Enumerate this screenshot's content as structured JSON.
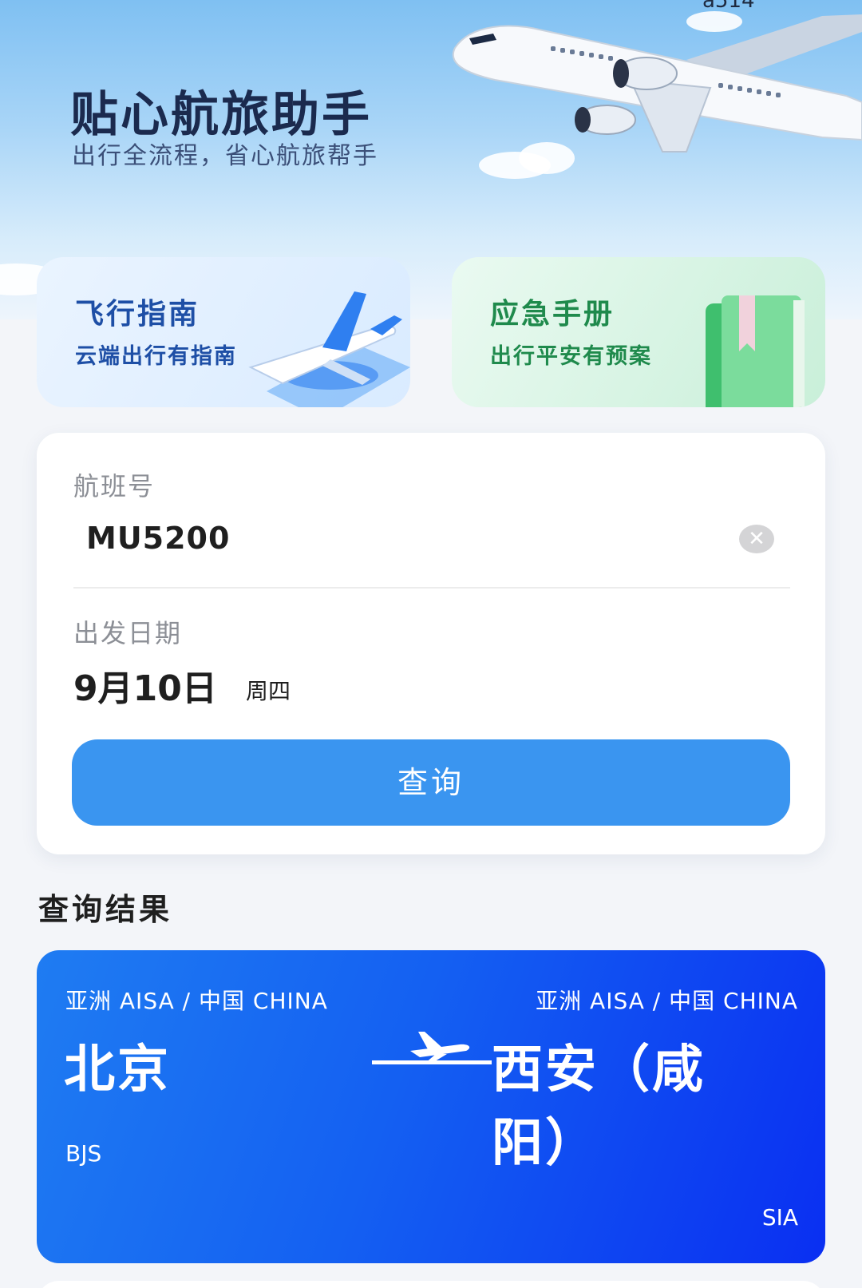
{
  "status_bar": {
    "clipped_text": "a514"
  },
  "hero": {
    "title": "贴心航旅助手",
    "subtitle": "出行全流程，省心航旅帮手"
  },
  "features": [
    {
      "title": "飞行指南",
      "desc": "云端出行有指南",
      "icon": "airplane-icon"
    },
    {
      "title": "应急手册",
      "desc": "出行平安有预案",
      "icon": "book-icon"
    }
  ],
  "form": {
    "flight_label": "航班号",
    "flight_value": "MU5200",
    "clear_icon": "clear-icon",
    "date_label": "出发日期",
    "date_value": "9月10日",
    "date_weekday": "周四",
    "query_label": "查询"
  },
  "results": {
    "title": "查询结果",
    "flight": {
      "departure": {
        "region": "亚洲 AISA / 中国 CHINA",
        "city": "北京",
        "code": "BJS"
      },
      "arrival": {
        "region": "亚洲 AISA / 中国 CHINA",
        "city": "西安（咸阳）",
        "code": "SIA"
      },
      "route_icon": "airplane-route-icon"
    }
  },
  "colors": {
    "accent": "#3a95f0",
    "result_card_start": "#1f7cf2",
    "result_card_end": "#0a2ff2",
    "guide_text": "#1e4fa6",
    "emergency_text": "#1f8a4c"
  }
}
